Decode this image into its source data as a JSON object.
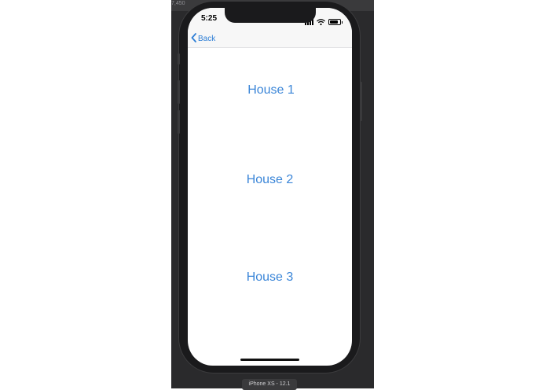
{
  "simulator": {
    "toolbar_text": "7,450",
    "device_label": "iPhone XS - 12.1"
  },
  "status_bar": {
    "time": "5:25",
    "battery_level": 0.85
  },
  "nav_bar": {
    "back_label": "Back"
  },
  "content": {
    "buttons": [
      {
        "label": "House 1"
      },
      {
        "label": "House 2"
      },
      {
        "label": "House 3"
      }
    ]
  },
  "colors": {
    "accent": "#2f7fd6",
    "background": "#ffffff"
  },
  "icons": [
    "chevron-left-icon",
    "wifi-icon",
    "battery-icon",
    "signal-icon"
  ]
}
